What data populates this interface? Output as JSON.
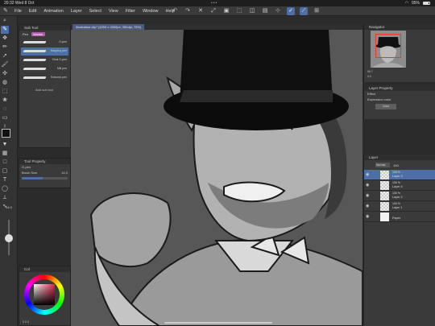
{
  "status": {
    "time": "20:32",
    "date": "Wed 8 Oct",
    "battery": "95%"
  },
  "menu": [
    "File",
    "Edit",
    "Animation",
    "Layer",
    "Select",
    "View",
    "Filter",
    "Window",
    "Help"
  ],
  "subtool": {
    "title": "Sub Tool",
    "tabs": [
      "Pen",
      "Marker"
    ],
    "brushes": [
      "G-pen",
      "Mapping pen",
      "Real G-pen",
      "Mill pen",
      "Textured pen"
    ],
    "add_label": "Add sub tool"
  },
  "tool_property": {
    "title": "Tool Property",
    "pen_label": "G-pen",
    "size_label": "Brush Size",
    "size_value": "14.0"
  },
  "size_slider": {
    "value": "14.0"
  },
  "color_panel": {
    "title": "Col",
    "values": "0 0 0"
  },
  "document": {
    "tab_label": "Illustration.clip* (4200 x 2000px, 350dpi, 75%)"
  },
  "navigator": {
    "title": "Navigator",
    "zoom": "66.7",
    "angle": "0.0"
  },
  "layer_property": {
    "title": "Layer Property",
    "effect_label": "Effect",
    "expression_label": "Expression color",
    "expression_value": "Color"
  },
  "layers_panel": {
    "title": "Layer",
    "blend": "Normal",
    "opacity": "100",
    "items": [
      {
        "opacity": "100 %",
        "name": "Layer 3"
      },
      {
        "opacity": "100 %",
        "name": "Layer 4"
      },
      {
        "opacity": "100 %",
        "name": "Layer 2"
      },
      {
        "opacity": "100 %",
        "name": "Layer 1"
      },
      {
        "opacity": "",
        "name": "Paper"
      }
    ]
  }
}
